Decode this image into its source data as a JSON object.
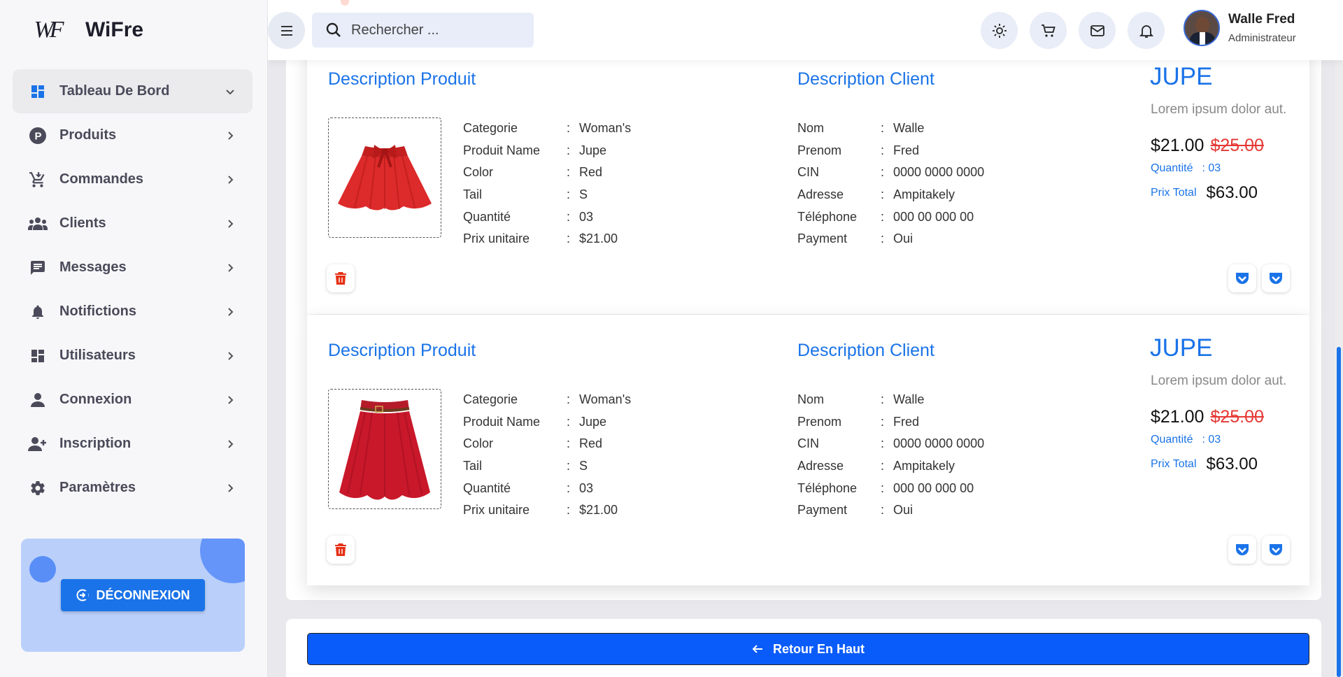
{
  "app": {
    "name": "WiFre",
    "logo_text": "WF"
  },
  "sidebar": {
    "items": [
      {
        "label": "Tableau De Bord",
        "icon": "dashboard-icon",
        "chevron": "down"
      },
      {
        "label": "Produits",
        "icon": "product-p-icon",
        "chevron": "right"
      },
      {
        "label": "Commandes",
        "icon": "cart-icon",
        "chevron": "right"
      },
      {
        "label": "Clients",
        "icon": "group-icon",
        "chevron": "right"
      },
      {
        "label": "Messages",
        "icon": "chat-icon",
        "chevron": "right"
      },
      {
        "label": "Notifictions",
        "icon": "bell-icon",
        "chevron": "right"
      },
      {
        "label": "Utilisateurs",
        "icon": "grid-icon",
        "chevron": "right"
      },
      {
        "label": "Connexion",
        "icon": "person-icon",
        "chevron": "right"
      },
      {
        "label": "Inscription",
        "icon": "person-add-icon",
        "chevron": "right"
      },
      {
        "label": "Paramètres",
        "icon": "gear-icon",
        "chevron": "right"
      }
    ],
    "logout_label": "DÉCONNEXION"
  },
  "header": {
    "search_placeholder": "Rechercher ...",
    "icons": [
      "sun-icon",
      "cart-icon",
      "mail-icon",
      "bell-icon"
    ],
    "user": {
      "name": "Walle Fred",
      "role": "Administrateur"
    }
  },
  "labels": {
    "product_title": "Description Produit",
    "client_title": "Description Client",
    "colon": ":",
    "qty_label": "Quantité",
    "total_label": "Prix Total"
  },
  "orders": [
    {
      "product": {
        "image": "red-bow-skirt",
        "fields": [
          {
            "k": "Categorie",
            "v": "Woman's"
          },
          {
            "k": "Produit Name",
            "v": "Jupe"
          },
          {
            "k": "Color",
            "v": "Red"
          },
          {
            "k": "Tail",
            "v": "S"
          },
          {
            "k": "Quantité",
            "v": "03"
          },
          {
            "k": "Prix unitaire",
            "v": "$21.00"
          }
        ]
      },
      "client": {
        "fields": [
          {
            "k": "Nom",
            "v": "Walle"
          },
          {
            "k": "Prenom",
            "v": "Fred"
          },
          {
            "k": "CIN",
            "v": "0000 0000 0000"
          },
          {
            "k": "Adresse",
            "v": "Ampitakely"
          },
          {
            "k": "Téléphone",
            "v": "000 00 000 00"
          },
          {
            "k": "Payment",
            "v": "Oui"
          }
        ]
      },
      "summary": {
        "name": "JUPE",
        "desc": "Lorem ipsum dolor aut.",
        "price": "$21.00",
        "old_price": "$25.00",
        "qty": ": 03",
        "total": "$63.00"
      }
    },
    {
      "product": {
        "image": "red-belted-skirt",
        "fields": [
          {
            "k": "Categorie",
            "v": "Woman's"
          },
          {
            "k": "Produit Name",
            "v": "Jupe"
          },
          {
            "k": "Color",
            "v": "Red"
          },
          {
            "k": "Tail",
            "v": "S"
          },
          {
            "k": "Quantité",
            "v": "03"
          },
          {
            "k": "Prix unitaire",
            "v": "$21.00"
          }
        ]
      },
      "client": {
        "fields": [
          {
            "k": "Nom",
            "v": "Walle"
          },
          {
            "k": "Prenom",
            "v": "Fred"
          },
          {
            "k": "CIN",
            "v": "0000 0000 0000"
          },
          {
            "k": "Adresse",
            "v": "Ampitakely"
          },
          {
            "k": "Téléphone",
            "v": "000 00 000 00"
          },
          {
            "k": "Payment",
            "v": "Oui"
          }
        ]
      },
      "summary": {
        "name": "JUPE",
        "desc": "Lorem ipsum dolor aut.",
        "price": "$21.00",
        "old_price": "$25.00",
        "qty": ": 03",
        "total": "$63.00"
      }
    }
  ],
  "back_to_top_label": "Retour En Haut",
  "colors": {
    "accent": "#1a73e8",
    "danger": "#e53935",
    "promo_bg": "#bad0fb"
  }
}
